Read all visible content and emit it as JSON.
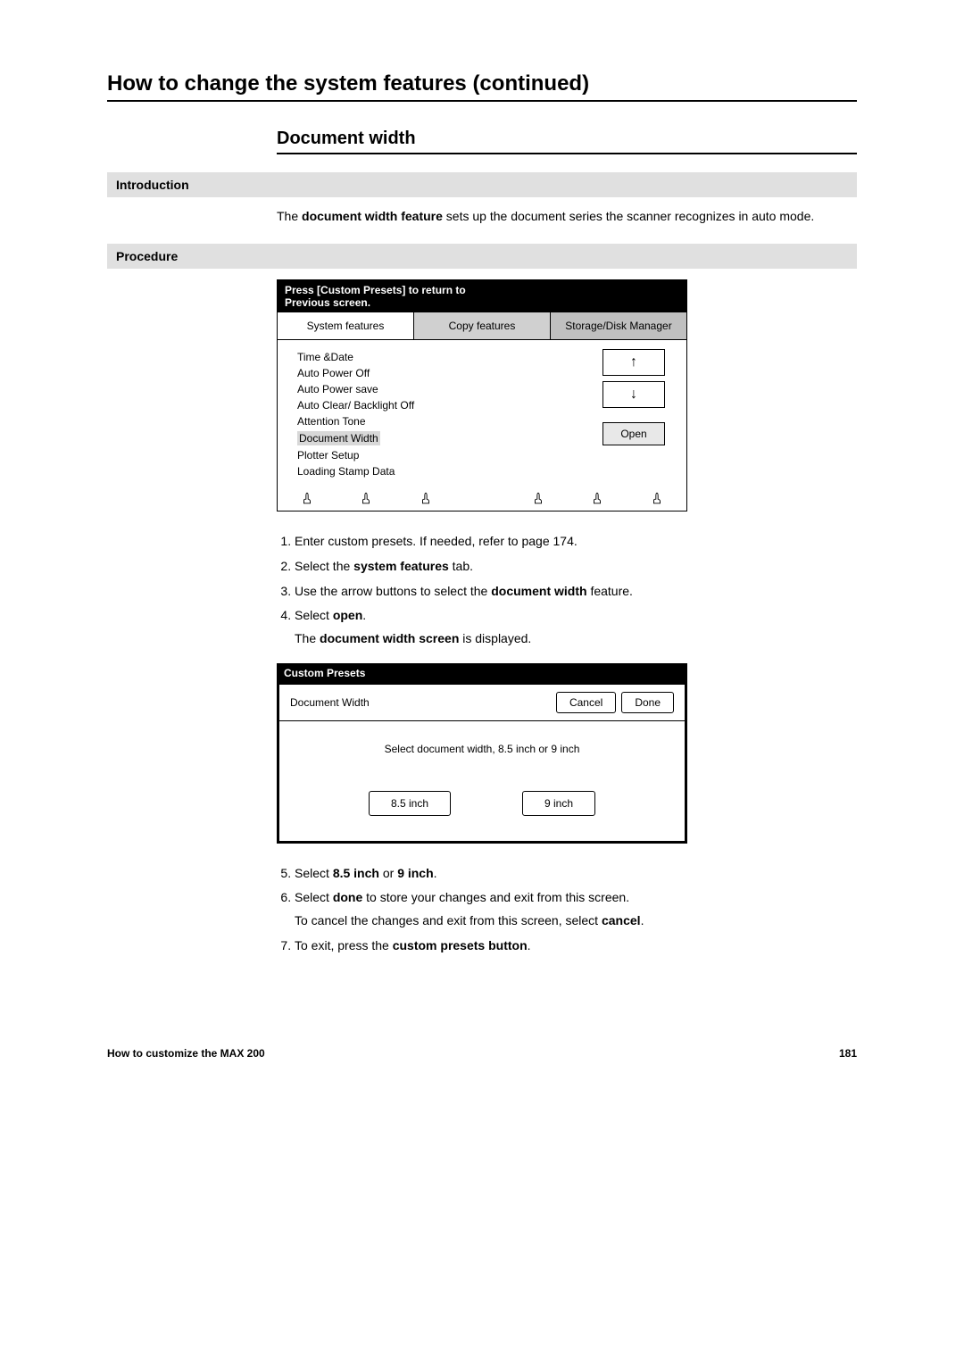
{
  "headings": {
    "main": "How to change the system features (continued)",
    "sub": "Document width",
    "intro_label": "Introduction",
    "procedure_label": "Procedure"
  },
  "intro_text_pre": "The ",
  "intro_text_bold": "document width feature",
  "intro_text_post": " sets up the document series the scanner recognizes in auto mode.",
  "screen1": {
    "title_line1": "Press [Custom Presets] to return to",
    "title_line2": "Previous screen.",
    "tabs": {
      "system": "System features",
      "copy": "Copy features",
      "storage": "Storage/Disk Manager"
    },
    "items": [
      "Time &Date",
      "Auto Power Off",
      "Auto Power save",
      "Auto Clear/ Backlight Off",
      "Attention Tone",
      "Document Width",
      "Plotter Setup",
      "Loading Stamp Data"
    ],
    "open_label": "Open",
    "up_arrow": "↑",
    "down_arrow": "↓"
  },
  "steps_a": {
    "s1": "Enter custom presets.  If needed, refer to page 174.",
    "s2_pre": "Select the ",
    "s2_bold": "system features",
    "s2_post": " tab.",
    "s3_pre": "Use the arrow buttons to select the ",
    "s3_bold": "document width",
    "s3_post": " feature.",
    "s4_pre": "Select ",
    "s4_bold": "open",
    "s4_post": ".",
    "s4_sub_pre": "The ",
    "s4_sub_bold": "document width screen",
    "s4_sub_post": " is displayed."
  },
  "screen2": {
    "title": "Custom Presets",
    "header_title": "Document Width",
    "cancel": "Cancel",
    "done": "Done",
    "prompt": "Select document width, 8.5 inch or 9 inch",
    "choice1": "8.5 inch",
    "choice2": "9 inch"
  },
  "steps_b": {
    "s5_pre": "Select ",
    "s5_bold1": "8.5 inch",
    "s5_mid": " or ",
    "s5_bold2": "9 inch",
    "s5_post": ".",
    "s6_pre": "Select ",
    "s6_bold": "done",
    "s6_post": " to store your changes and exit from this screen.",
    "s6_sub_pre": "To cancel the changes and exit from this screen, select ",
    "s6_sub_bold": "cancel",
    "s6_sub_post": ".",
    "s7_pre": "To exit, press the ",
    "s7_bold": "custom presets button",
    "s7_post": "."
  },
  "footer": {
    "left": "How to customize the MAX 200",
    "right": "181"
  }
}
